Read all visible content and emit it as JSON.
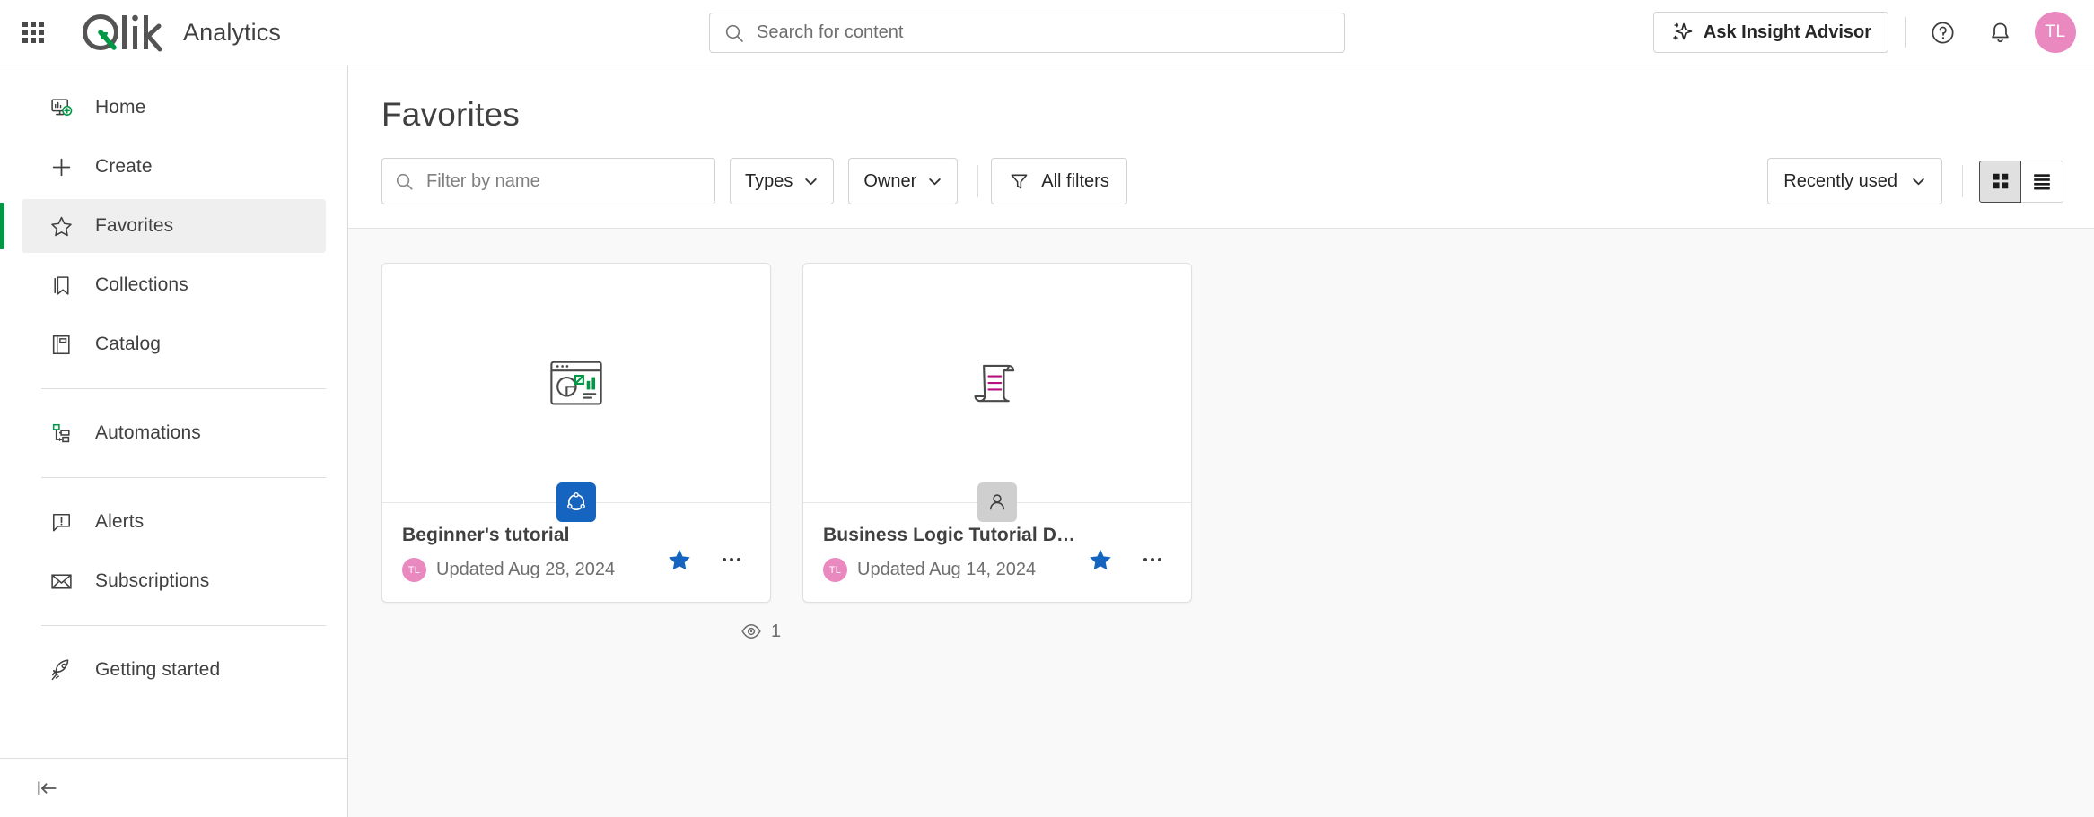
{
  "header": {
    "app_launcher_icon": "grid-apps-icon",
    "brand_name": "Qlik",
    "product_name": "Analytics",
    "search": {
      "placeholder": "Search for content",
      "value": "",
      "icon": "search-icon"
    },
    "insight_advisor_label": "Ask Insight Advisor",
    "insight_advisor_icon": "sparkle-icon",
    "help_icon": "help-circle-icon",
    "notifications_icon": "bell-icon",
    "avatar_initials": "TL",
    "avatar_color": "#e989c0"
  },
  "sidebar": {
    "collapse_icon": "collapse-sidebar-icon",
    "active_accent_color": "#009845",
    "items": [
      {
        "label": "Home",
        "icon": "home-monitor-plus-icon",
        "active": false
      },
      {
        "label": "Create",
        "icon": "plus-icon",
        "active": false
      },
      {
        "label": "Favorites",
        "icon": "star-outline-icon",
        "active": true
      },
      {
        "label": "Collections",
        "icon": "bookmark-icon",
        "active": false
      },
      {
        "label": "Catalog",
        "icon": "book-icon",
        "active": false
      },
      {
        "label": "Automations",
        "icon": "automations-flow-icon",
        "active": false
      },
      {
        "label": "Alerts",
        "icon": "alert-bubble-icon",
        "active": false
      },
      {
        "label": "Subscriptions",
        "icon": "envelope-icon",
        "active": false
      },
      {
        "label": "Getting started",
        "icon": "rocket-icon",
        "active": false
      }
    ]
  },
  "main": {
    "page_title": "Favorites",
    "toolbar": {
      "filter_placeholder": "Filter by name",
      "filter_value": "",
      "filter_icon": "search-icon",
      "types_label": "Types",
      "owner_label": "Owner",
      "all_filters_label": "All filters",
      "all_filters_icon": "funnel-icon",
      "sort_label": "Recently used",
      "grid_view_icon": "grid-view-icon",
      "list_view_icon": "list-view-icon",
      "active_view": "grid"
    },
    "cards": [
      {
        "name": "Beginner's tutorial",
        "updated": "Updated Aug 28, 2024",
        "owner_initials": "TL",
        "thumb_icon": "app-chart-window-icon",
        "badge_icon": "qlik-app-icon",
        "badge_type": "app",
        "badge_color": "#1565c0",
        "favorited": true,
        "star_color": "#1565c0",
        "more_icon": "more-horizontal-icon"
      },
      {
        "name": "Business Logic Tutorial Data Prep",
        "updated": "Updated Aug 14, 2024",
        "owner_initials": "TL",
        "thumb_icon": "script-scroll-icon",
        "badge_icon": "person-icon",
        "badge_type": "doc",
        "badge_color": "#cfcfcf",
        "favorited": true,
        "star_color": "#1565c0",
        "more_icon": "more-horizontal-icon"
      }
    ],
    "view_count": {
      "icon": "eye-icon",
      "value": "1"
    }
  }
}
